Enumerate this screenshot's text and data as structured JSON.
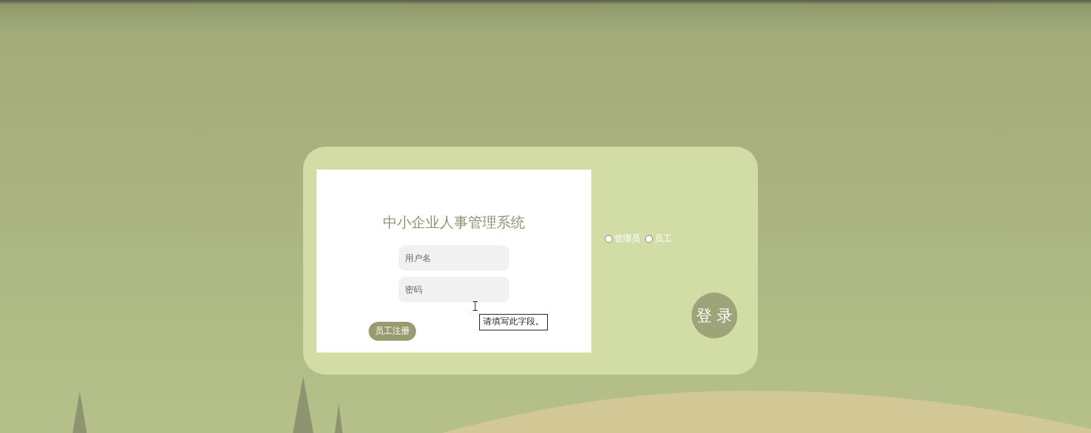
{
  "login_panel": {
    "title": "中小企业人事管理系统",
    "fields": [
      {
        "placeholder": "用户名"
      },
      {
        "placeholder": "密码"
      }
    ],
    "register_button": "员工注册",
    "validation_tooltip": "请填写此字段。"
  },
  "roles": [
    {
      "label": "管理员",
      "selected": false
    },
    {
      "label": "员工",
      "selected": false
    }
  ],
  "login_button": "登 录"
}
